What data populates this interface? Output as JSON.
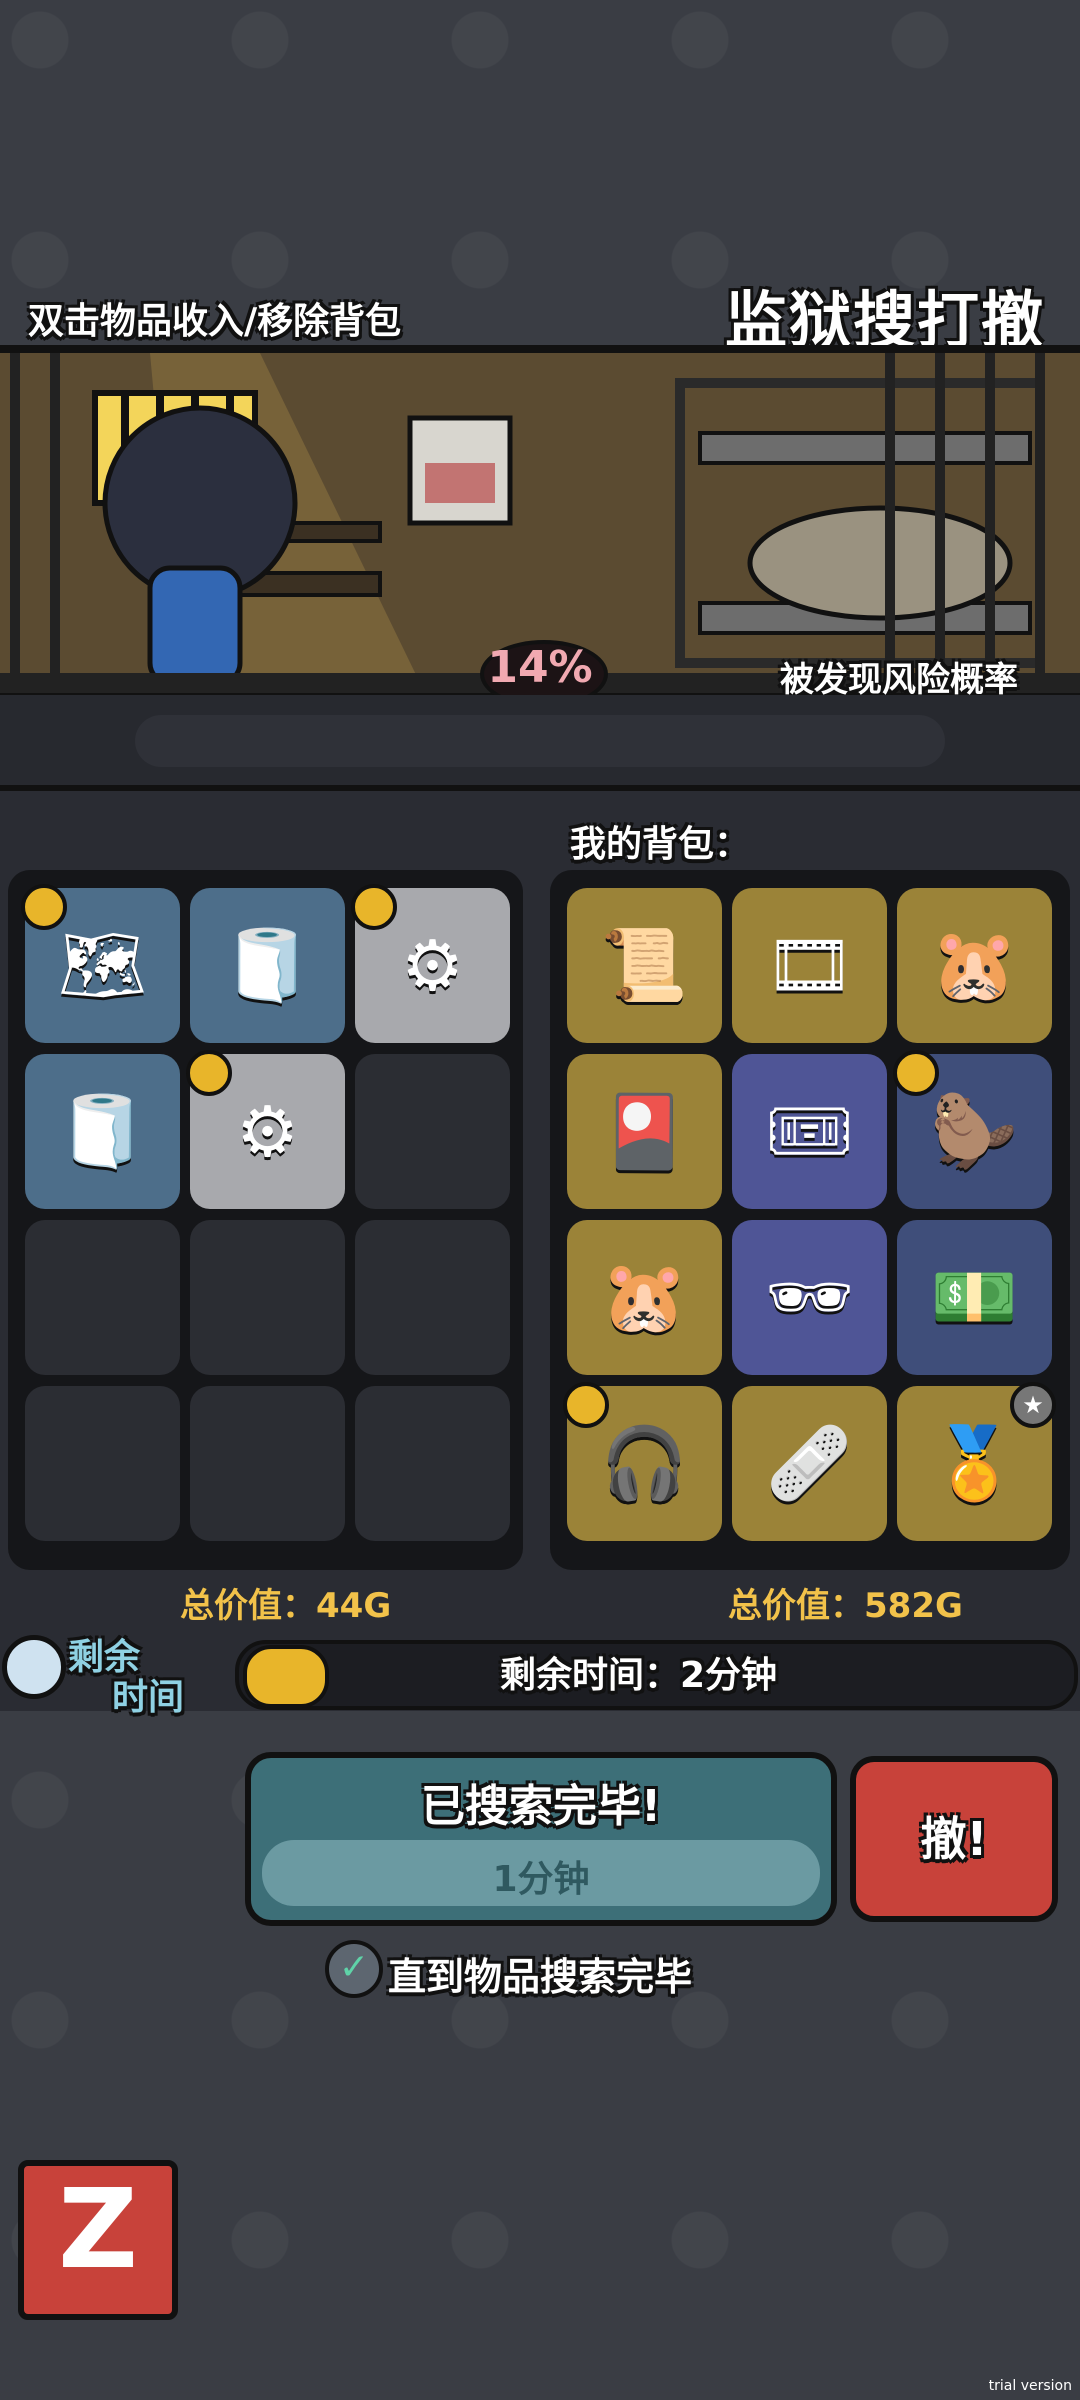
{
  "header": {
    "hint": "双击物品收入/移除背包",
    "logo": "监狱搜打撤"
  },
  "scene": {
    "risk_value": "14%",
    "risk_label": "被发现风险概率"
  },
  "container": {
    "total_label": "总价值：44G",
    "slots": [
      {
        "bg": "blue",
        "icon": "map-icon",
        "glyph": "🗺",
        "coin": true
      },
      {
        "bg": "blue",
        "icon": "toilet-paper-icon",
        "glyph": "🧻",
        "coin": false
      },
      {
        "bg": "grey",
        "icon": "scrap-metal-icon",
        "glyph": "⚙",
        "coin": true
      },
      {
        "bg": "blue",
        "icon": "toilet-paper-icon",
        "glyph": "🧻",
        "coin": false
      },
      {
        "bg": "grey",
        "icon": "scrap-metal-icon",
        "glyph": "⚙",
        "coin": true
      },
      {
        "bg": "empty"
      },
      {
        "bg": "empty"
      },
      {
        "bg": "empty"
      },
      {
        "bg": "empty"
      },
      {
        "bg": "empty"
      },
      {
        "bg": "empty"
      },
      {
        "bg": "empty"
      }
    ]
  },
  "bag": {
    "title": "我的背包：",
    "total_label": "总价值：582G",
    "slots": [
      {
        "bg": "gold",
        "icon": "old-map-icon",
        "glyph": "📜",
        "coin": false
      },
      {
        "bg": "gold",
        "icon": "film-reel-icon",
        "glyph": "🎞",
        "coin": false
      },
      {
        "bg": "gold",
        "icon": "capybara-pack-icon",
        "glyph": "🐹",
        "coin": false
      },
      {
        "bg": "gold",
        "icon": "gold-card-icon",
        "glyph": "🎴",
        "coin": false
      },
      {
        "bg": "purple",
        "icon": "ticket-icon",
        "glyph": "🎟",
        "coin": false
      },
      {
        "bg": "dblue",
        "icon": "capybara-plush-icon",
        "glyph": "🦫",
        "coin": true
      },
      {
        "bg": "gold",
        "icon": "capybara-pack-icon",
        "glyph": "🐹",
        "coin": false
      },
      {
        "bg": "purple",
        "icon": "sunglasses-magazine-icon",
        "glyph": "🕶",
        "coin": false
      },
      {
        "bg": "dblue",
        "icon": "money-pills-icon",
        "glyph": "💵",
        "coin": false
      },
      {
        "bg": "gold",
        "icon": "earbud-icon",
        "glyph": "🎧",
        "coin": true
      },
      {
        "bg": "gold",
        "icon": "first-aid-card-icon",
        "glyph": "🩹",
        "coin": false
      },
      {
        "bg": "gold",
        "icon": "gold-plate-icon",
        "glyph": "🏅",
        "coin": false,
        "star": true
      }
    ]
  },
  "timer": {
    "label_line1": "剩余",
    "label_line2": "时间",
    "text": "剩余时间：2分钟",
    "coin_color": "#e8b52a"
  },
  "actions": {
    "search_done": "已搜索完毕!",
    "search_time": "1分钟",
    "escape": "撤!",
    "checkbox_checked": true,
    "checkbox_label": "直到物品搜索完毕",
    "back_glyph": "Z"
  },
  "watermark": "trial version",
  "colors": {
    "gold_text": "#f2c24a",
    "escape_red": "#c8423a",
    "search_teal": "#3d6f78"
  }
}
